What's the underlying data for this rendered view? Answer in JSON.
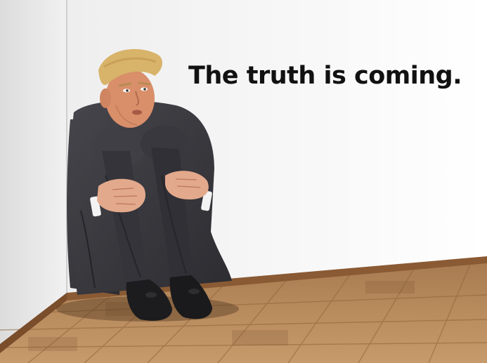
{
  "caption": {
    "text": "The truth is coming."
  },
  "colors": {
    "wall": "#f2f2f2",
    "floor_light": "#b98c5e",
    "floor_dark": "#7e5430",
    "baseboard": "#8a5a34",
    "suit": "#3b3b40",
    "hair": "#d8b36a",
    "skin": "#d98f6a",
    "shoe": "#1c1c1e",
    "caption_text": "#111111"
  }
}
